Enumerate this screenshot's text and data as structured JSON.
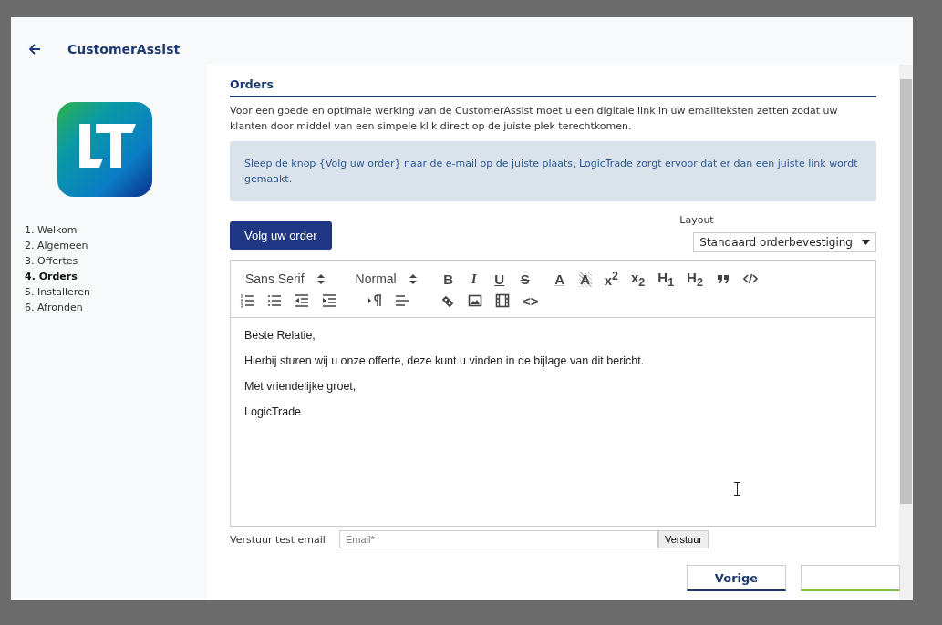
{
  "header": {
    "title": "CustomerAssist"
  },
  "steps": [
    {
      "label": "1. Welkom",
      "selected": false
    },
    {
      "label": "2. Algemeen",
      "selected": false
    },
    {
      "label": "3. Offertes",
      "selected": false
    },
    {
      "label": "4. Orders",
      "selected": true
    },
    {
      "label": "5. Installeren",
      "selected": false
    },
    {
      "label": "6. Afronden",
      "selected": false
    }
  ],
  "section": {
    "title": "Orders",
    "intro": "Voor een goede en optimale werking van de CustomerAssist moet u een digitale link in uw emailteksten zetten zodat uw klanten door middel van een simpele klik direct op de juiste plek terechtkomen.",
    "info": "Sleep de knop {Volg uw order} naar de e-mail op de juiste plaats, LogicTrade zorgt ervoor dat er dan een juiste link wordt gemaakt."
  },
  "drag_button": "Volg uw order",
  "layout": {
    "label": "Layout",
    "value": "Standaard orderbevestiging"
  },
  "toolbar": [
    [
      {
        "kind": "select",
        "text": "Sans Serif"
      },
      {
        "kind": "select",
        "text": "Normal"
      },
      {
        "kind": "bold",
        "text": "B"
      },
      {
        "kind": "italic",
        "text": "I"
      },
      {
        "kind": "underline",
        "text": "U"
      },
      {
        "kind": "strike",
        "text": "S"
      },
      {
        "kind": "color",
        "text": "A"
      },
      {
        "kind": "background",
        "text": "A"
      },
      {
        "kind": "glyph",
        "text": "x$^{2}$"
      },
      {
        "kind": "glyph",
        "text": "x$_{2}$"
      },
      {
        "kind": "glyph",
        "text": "H$_{1}$"
      },
      {
        "kind": "glyph",
        "text": "H$_{2}$"
      },
      {
        "kind": "quote"
      },
      {
        "kind": "code"
      }
    ],
    [
      {
        "kind": "ordered-list"
      },
      {
        "kind": "bullet-list"
      },
      {
        "kind": "outdent"
      },
      {
        "kind": "indent"
      },
      {
        "kind": "paragraph"
      },
      {
        "kind": "align"
      },
      {
        "kind": "link"
      },
      {
        "kind": "image"
      },
      {
        "kind": "video"
      },
      {
        "kind": "glyph",
        "text": "<>"
      }
    ]
  ],
  "editor": [
    "Beste Relatie,",
    "Hierbij sturen wij u onze offerte, deze kunt u vinden in de bijlage van dit bericht.",
    "Met vriendelijke groet,",
    "LogicTrade"
  ],
  "test_email": {
    "label": "Verstuur test email",
    "placeholder": "Email*",
    "button": "Verstuur"
  },
  "footer": {
    "back": "Vorige"
  }
}
